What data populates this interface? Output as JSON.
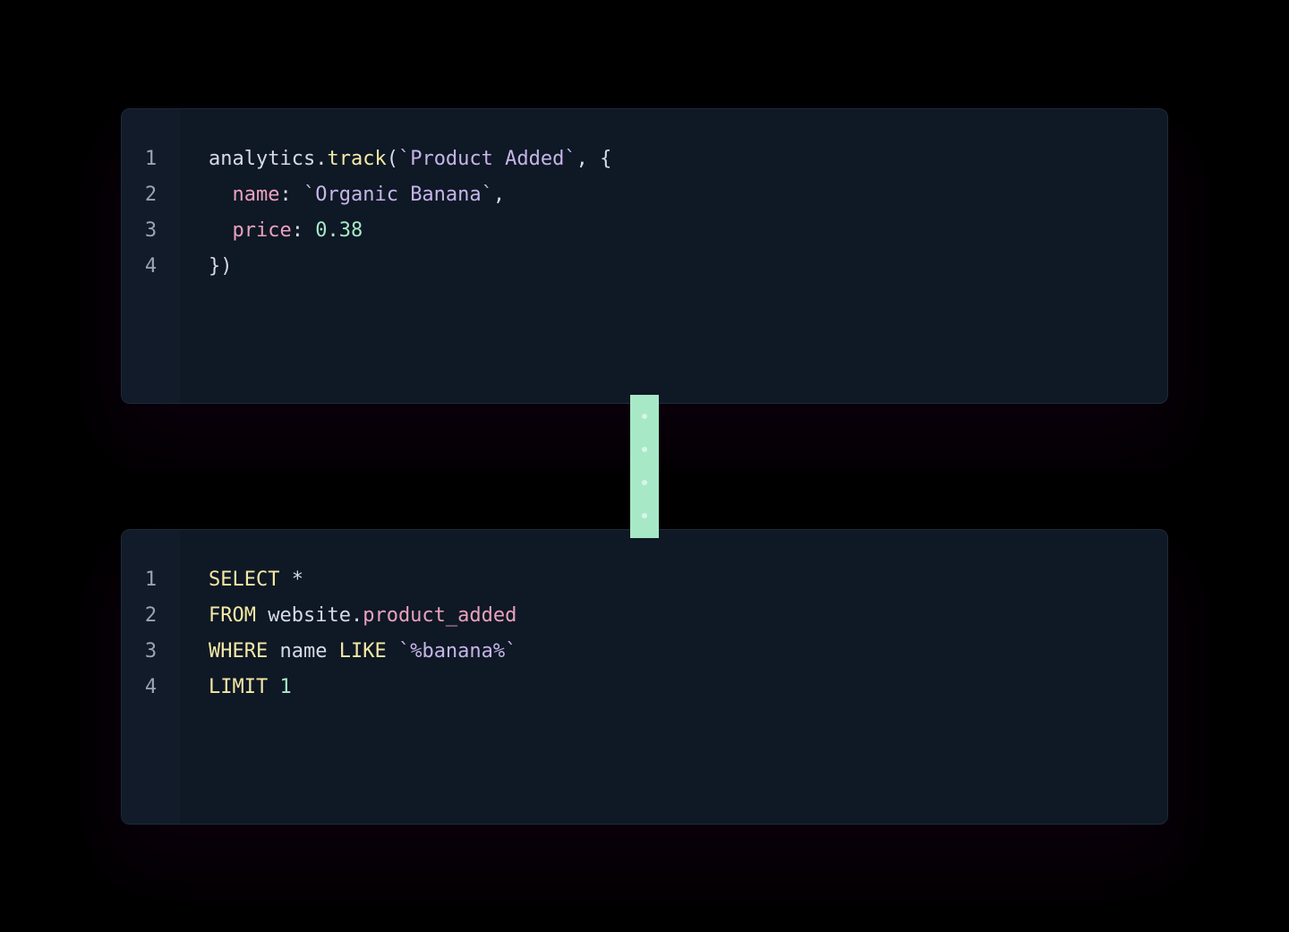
{
  "block1": {
    "numbers": [
      "1",
      "2",
      "3",
      "4"
    ],
    "lines": [
      [
        {
          "cls": "tok-default",
          "t": "analytics"
        },
        {
          "cls": "tok-default",
          "t": "."
        },
        {
          "cls": "tok-method",
          "t": "track"
        },
        {
          "cls": "tok-default",
          "t": "("
        },
        {
          "cls": "tok-string",
          "t": "`Product Added`"
        },
        {
          "cls": "tok-default",
          "t": ", {"
        }
      ],
      [
        {
          "cls": "tok-default",
          "t": "  "
        },
        {
          "cls": "tok-prop",
          "t": "name"
        },
        {
          "cls": "tok-default",
          "t": ": "
        },
        {
          "cls": "tok-string",
          "t": "`Organic Banana`"
        },
        {
          "cls": "tok-default",
          "t": ","
        }
      ],
      [
        {
          "cls": "tok-default",
          "t": "  "
        },
        {
          "cls": "tok-prop",
          "t": "price"
        },
        {
          "cls": "tok-default",
          "t": ": "
        },
        {
          "cls": "tok-number",
          "t": "0.38"
        }
      ],
      [
        {
          "cls": "tok-default",
          "t": "})"
        }
      ]
    ]
  },
  "block2": {
    "numbers": [
      "1",
      "2",
      "3",
      "4"
    ],
    "lines": [
      [
        {
          "cls": "tok-keyword",
          "t": "SELECT"
        },
        {
          "cls": "tok-default",
          "t": " *"
        }
      ],
      [
        {
          "cls": "tok-keyword",
          "t": "FROM"
        },
        {
          "cls": "tok-default",
          "t": " website"
        },
        {
          "cls": "tok-default",
          "t": "."
        },
        {
          "cls": "tok-prop",
          "t": "product_added"
        }
      ],
      [
        {
          "cls": "tok-keyword",
          "t": "WHERE"
        },
        {
          "cls": "tok-default",
          "t": " name "
        },
        {
          "cls": "tok-keyword",
          "t": "LIKE"
        },
        {
          "cls": "tok-default",
          "t": " "
        },
        {
          "cls": "tok-string",
          "t": "`%banana%`"
        }
      ],
      [
        {
          "cls": "tok-keyword",
          "t": "LIMIT"
        },
        {
          "cls": "tok-default",
          "t": " "
        },
        {
          "cls": "tok-number",
          "t": "1"
        }
      ]
    ]
  }
}
